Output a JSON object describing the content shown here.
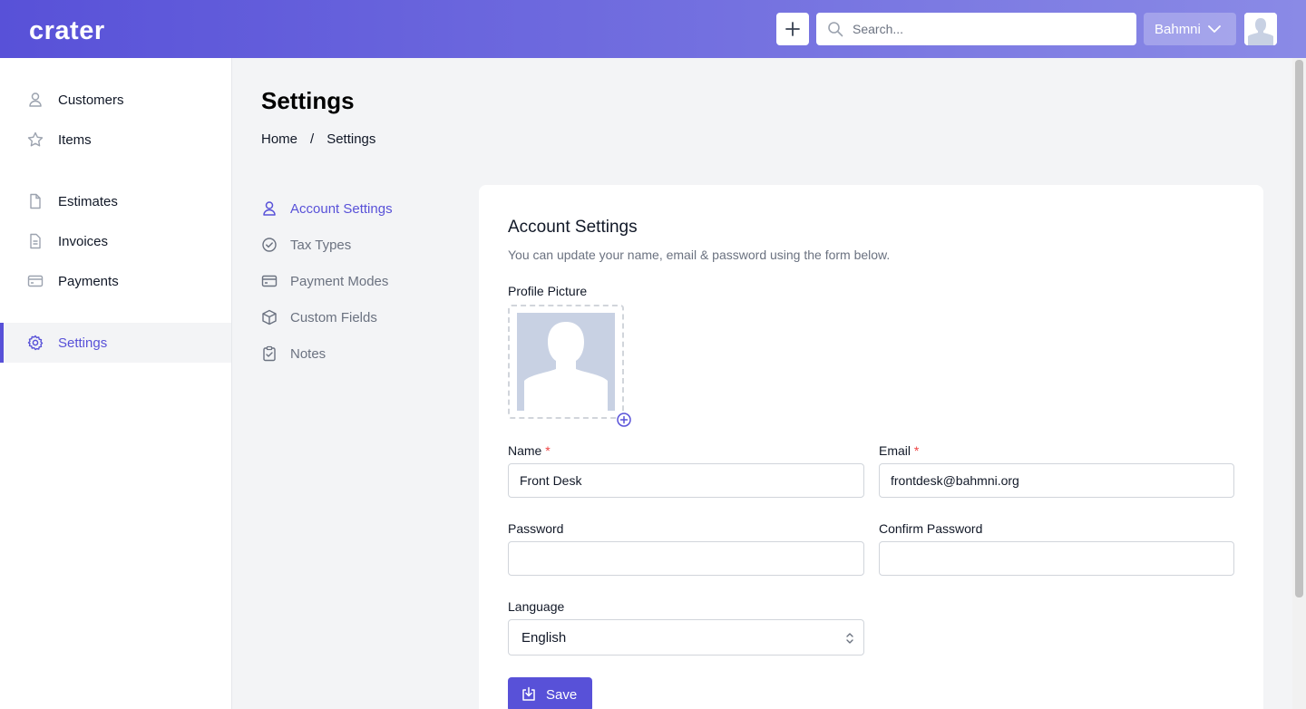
{
  "header": {
    "logo": "crater",
    "search_placeholder": "Search...",
    "company": "Bahmni",
    "icons": {
      "add": "plus-icon",
      "search": "search-icon",
      "dropdown": "chevron-down-icon",
      "avatar": "user-avatar"
    }
  },
  "sidebar": {
    "items": [
      {
        "label": "Customers",
        "icon": "user-icon"
      },
      {
        "label": "Items",
        "icon": "star-icon"
      },
      {
        "label": "Estimates",
        "icon": "document-icon"
      },
      {
        "label": "Invoices",
        "icon": "document-text-icon"
      },
      {
        "label": "Payments",
        "icon": "credit-card-icon"
      },
      {
        "label": "Settings",
        "icon": "gear-icon",
        "active": true
      }
    ]
  },
  "page": {
    "title": "Settings",
    "breadcrumb": {
      "home": "Home",
      "separator": "/",
      "current": "Settings"
    }
  },
  "settings_nav": {
    "items": [
      {
        "label": "Account Settings",
        "icon": "user-icon",
        "active": true
      },
      {
        "label": "Tax Types",
        "icon": "check-circle-icon"
      },
      {
        "label": "Payment Modes",
        "icon": "credit-card-icon"
      },
      {
        "label": "Custom Fields",
        "icon": "cube-icon"
      },
      {
        "label": "Notes",
        "icon": "clipboard-check-icon"
      }
    ]
  },
  "account": {
    "title": "Account Settings",
    "subtitle": "You can update your name, email & password using the form below.",
    "profile_picture_label": "Profile Picture",
    "name_label": "Name",
    "name_value": "Front Desk",
    "email_label": "Email",
    "email_value": "frontdesk@bahmni.org",
    "required_mark": "*",
    "password_label": "Password",
    "password_value": "",
    "confirm_password_label": "Confirm Password",
    "confirm_password_value": "",
    "language_label": "Language",
    "language_value": "English",
    "save_label": "Save"
  },
  "colors": {
    "primary": "#5851d8",
    "header_gradient_end": "#8a8ae6",
    "required": "#ef4444",
    "muted_text": "#6b7280"
  }
}
